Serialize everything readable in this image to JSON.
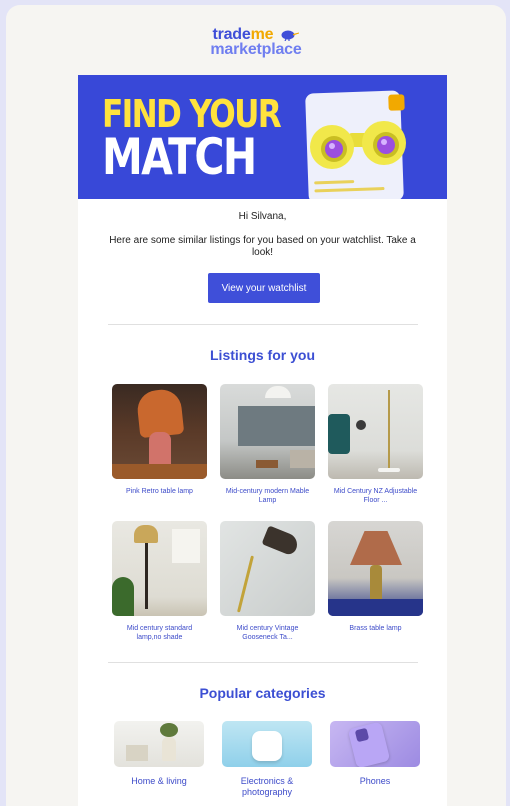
{
  "brand": {
    "line1_a": "trade",
    "line1_b": "me",
    "line2": "marketplace"
  },
  "hero": {
    "line1": "FIND YOUR",
    "line2": "MATCH"
  },
  "greeting": "Hi Silvana,",
  "intro": "Here are some similar listings for you based on your watchlist. Take a look!",
  "cta": {
    "label": "View your watchlist"
  },
  "listings": {
    "title": "Listings for you",
    "items": [
      {
        "caption": "Pink Retro table lamp"
      },
      {
        "caption": "Mid-century modern Mable Lamp"
      },
      {
        "caption": "Mid Century NZ Adjustable Floor ..."
      },
      {
        "caption": "Mid century standard lamp,no shade"
      },
      {
        "caption": "Mid century Vintage Gooseneck Ta..."
      },
      {
        "caption": "Brass table lamp"
      }
    ]
  },
  "categories": {
    "title": "Popular categories",
    "items": [
      {
        "caption": "Home & living"
      },
      {
        "caption": "Electronics & photography"
      },
      {
        "caption": "Phones"
      }
    ]
  },
  "colors": {
    "accent": "#3f4fd9",
    "brand_yellow": "#f2a900",
    "hero_bg": "#3848d8",
    "page_bg": "#e3e4f7"
  }
}
